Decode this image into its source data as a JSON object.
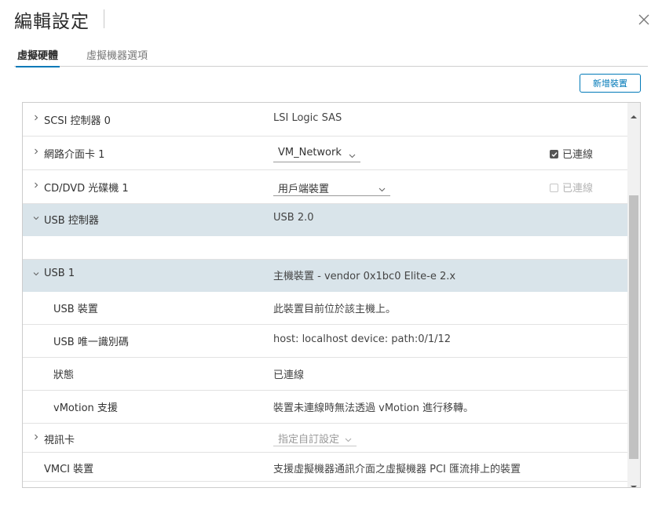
{
  "dialog": {
    "title": "編輯設定",
    "close_icon": "close-icon"
  },
  "tabs": [
    {
      "label": "虛擬硬體",
      "active": true
    },
    {
      "label": "虛擬機器選項",
      "active": false
    }
  ],
  "toolbar": {
    "add_device_label": "新增裝置"
  },
  "colors": {
    "accent": "#0079b8",
    "selected_row": "#d9e4ea"
  },
  "rows": {
    "scsi": {
      "label": "SCSI 控制器 0",
      "value": "LSI Logic SAS"
    },
    "nic": {
      "label": "網路介面卡 1",
      "select": "VM_Network",
      "check_label": "已連線",
      "checked": true
    },
    "cdrom": {
      "label": "CD/DVD 光碟機 1",
      "select": "用戶端裝置",
      "check_label": "已連線",
      "checked": false
    },
    "usb_ctrl": {
      "label": "USB 控制器",
      "value": "USB 2.0"
    },
    "usb1": {
      "label": "USB 1",
      "value": "主機裝置 - vendor 0x1bc0 Elite-e 2.x"
    },
    "usb_device": {
      "label": "USB 裝置",
      "value": "此裝置目前位於該主機上。"
    },
    "usb_id": {
      "label": "USB 唯一識別碼",
      "value": "host: localhost device: path:0/1/12"
    },
    "status": {
      "label": "狀態",
      "value": "已連線"
    },
    "vmotion": {
      "label": "vMotion 支援",
      "value": "裝置未連線時無法透過 vMotion 進行移轉。"
    },
    "video": {
      "label": "視訊卡",
      "select": "指定自訂設定"
    },
    "vmci": {
      "label": "VMCI 裝置",
      "value": "支援虛擬機器通訊介面之虛擬機器 PCI 匯流排上的裝置"
    }
  }
}
